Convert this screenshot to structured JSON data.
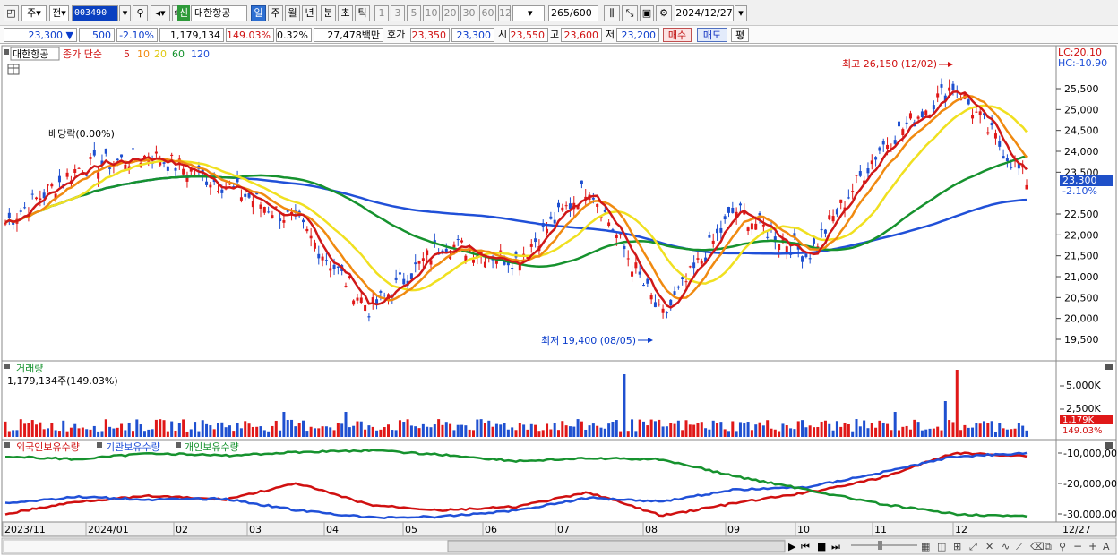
{
  "toolbar": {
    "stock_code": "003490",
    "stock_name": "대한항공",
    "credit_badge": "신",
    "type_label": "주",
    "prev_label": "전",
    "period_tabs": [
      "일",
      "주",
      "월",
      "년",
      "분",
      "초",
      "틱"
    ],
    "active_period": "일",
    "interval_buttons": [
      "1",
      "3",
      "5",
      "10",
      "20",
      "30",
      "60",
      "120"
    ],
    "count": "265",
    "count_max": "/600",
    "date": "2024/12/27"
  },
  "price_bar": {
    "price": "23,300",
    "change": "500",
    "change_pct": "-2.10%",
    "volume": "1,179,134",
    "volume_ratio": "149.03%",
    "turnover": "0.32%",
    "amount": "27,478백만",
    "quote_label": "호가",
    "quote1": "23,350",
    "quote2": "23,300",
    "open_label": "시",
    "open": "23,550",
    "high_label": "고",
    "high": "23,600",
    "low_label": "저",
    "low": "23,200",
    "buy_label": "매수",
    "sell_label": "매도",
    "eval_label": "평"
  },
  "price_panel": {
    "legend_name": "대한항공",
    "legend_series": "종가 단순",
    "ma_periods": [
      "5",
      "10",
      "20",
      "60",
      "120"
    ],
    "ma_colors": [
      "#d01818",
      "#f08a10",
      "#f0e020",
      "#16922e",
      "#2050d8"
    ],
    "lc_label": "LC:20.10",
    "hc_label": "HC:-10.90",
    "max_annotation": "최고 26,150 (12/02)",
    "min_annotation": "최저 19,400 (08/05)",
    "dividend_annotation": "배당락(0.00%)",
    "current_price": "23,300",
    "current_change": "-2.10%",
    "y_ticks": [
      "25,500",
      "25,000",
      "24,500",
      "24,000",
      "23,500",
      "22,500",
      "22,000",
      "21,500",
      "21,000",
      "20,500",
      "20,000",
      "19,500"
    ]
  },
  "volume_panel": {
    "title": "거래량",
    "value_label": "1,179,134주(149.03%)",
    "y_ticks": [
      "5,000K",
      "2,500K"
    ],
    "current_label": "1,179K",
    "current_pct": "149.03%"
  },
  "holding_panel": {
    "legend": [
      "외국인보유수량",
      "기관보유수량",
      "개인보유수량"
    ],
    "colors": [
      "#d01010",
      "#2050d8",
      "#16922e"
    ],
    "y_ticks": [
      "-10,000,00",
      "-20,000,00",
      "-30,000,00"
    ]
  },
  "x_axis": {
    "labels": [
      "2023/11",
      "2024/01",
      "02",
      "03",
      "04",
      "05",
      "06",
      "07",
      "08",
      "09",
      "10",
      "11",
      "12"
    ],
    "end_label": "12/27"
  },
  "chart_data": {
    "type": "line",
    "ylim": [
      19400,
      26150
    ],
    "series": [
      {
        "name": "종가",
        "x": [
          "2023/11",
          "2023/12",
          "2024/01",
          "2024/02",
          "2024/03",
          "2024/04",
          "2024/05",
          "2024/06",
          "2024/07",
          "2024/08",
          "2024/09",
          "2024/10",
          "2024/11",
          "2024/12",
          "2024/12/27"
        ],
        "values": [
          22300,
          23600,
          23900,
          23200,
          22300,
          20200,
          21800,
          21400,
          23200,
          20000,
          22600,
          21500,
          24100,
          25600,
          23300
        ]
      }
    ]
  }
}
